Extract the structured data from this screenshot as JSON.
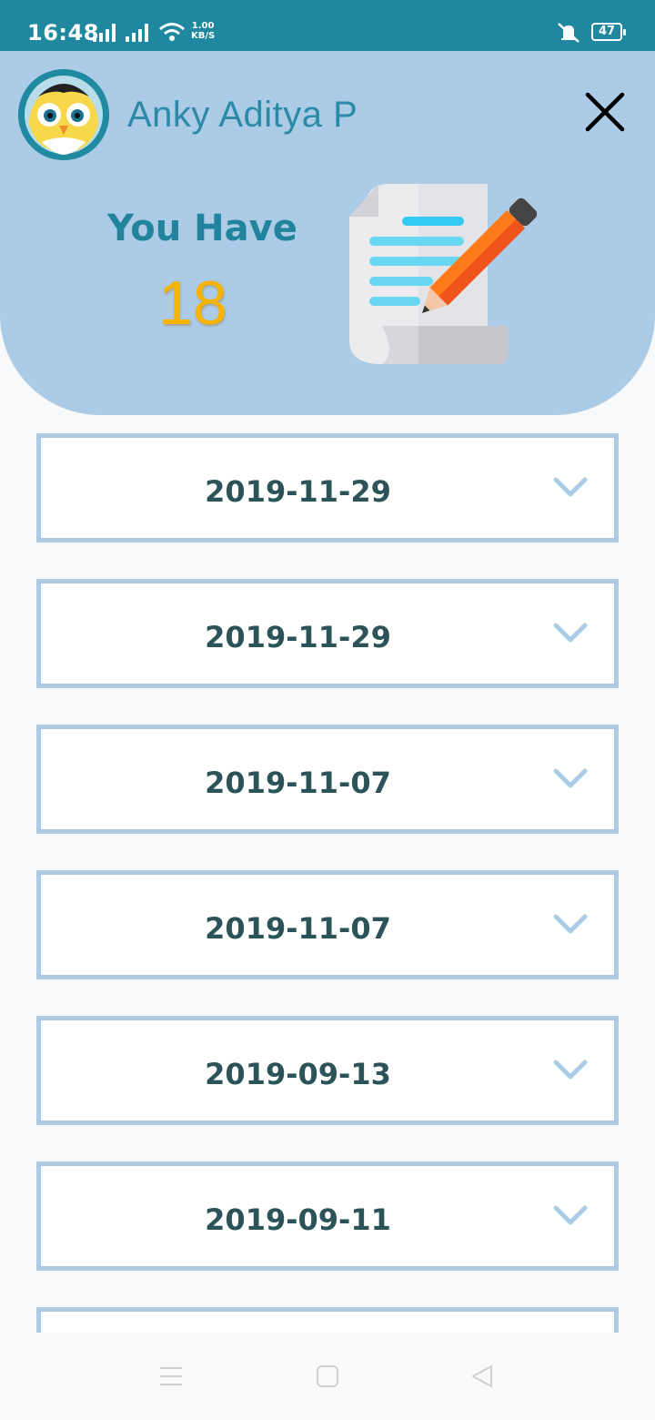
{
  "status_bar": {
    "time": "16:48",
    "speed_value": "1.00",
    "speed_unit": "KB/S",
    "battery": "47"
  },
  "header": {
    "user_name": "Anky Aditya P",
    "heading": "You Have",
    "count": "18"
  },
  "records": [
    {
      "date": "2019-11-29"
    },
    {
      "date": "2019-11-29"
    },
    {
      "date": "2019-11-07"
    },
    {
      "date": "2019-11-07"
    },
    {
      "date": "2019-09-13"
    },
    {
      "date": "2019-09-11"
    },
    {
      "date": ""
    }
  ],
  "colors": {
    "status_bar": "#1f889f",
    "header_bg": "#abcbe6",
    "card_border": "#abcbe6",
    "date_text": "#2b5358",
    "count_text": "#f6b400"
  },
  "icons": {
    "close": "close-icon",
    "expand": "chevron-down-icon",
    "nav_menu": "menu-icon",
    "nav_home": "home-square-icon",
    "nav_back": "back-triangle-icon"
  }
}
